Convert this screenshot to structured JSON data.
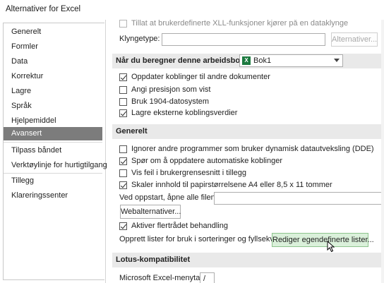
{
  "window": {
    "title": "Alternativer for Excel"
  },
  "sidebar": {
    "items": [
      {
        "label": "Generelt"
      },
      {
        "label": "Formler"
      },
      {
        "label": "Data"
      },
      {
        "label": "Korrektur"
      },
      {
        "label": "Lagre"
      },
      {
        "label": "Språk"
      },
      {
        "label": "Hjelpemiddel"
      },
      {
        "label": "Avansert",
        "active": true
      },
      {
        "label": "Tilpass båndet"
      },
      {
        "label": "Verktøylinje for hurtigtilgang"
      },
      {
        "label": "Tillegg"
      },
      {
        "label": "Klareringssenter"
      }
    ]
  },
  "top": {
    "faded_row": "Tillat at brukerdefinerte XLL-funksjoner kjører på en dataklynge",
    "klyngetype_label": "Klyngetype:",
    "alternativer_button": "Alternativer..."
  },
  "calc_section": {
    "header": "Når du beregner denne arbeidsboken:",
    "workbook": "Bok1",
    "options": [
      {
        "label": "Oppdater koblinger til andre dokumenter",
        "checked": true
      },
      {
        "label": "Angi presisjon som vist",
        "checked": false
      },
      {
        "label": "Bruk 1904-datosystem",
        "checked": false
      },
      {
        "label": "Lagre eksterne koblingsverdier",
        "checked": true
      }
    ]
  },
  "general_section": {
    "header": "Generelt",
    "options": [
      {
        "label": "Ignorer andre programmer som bruker dynamisk datautveksling (DDE)",
        "checked": false
      },
      {
        "label": "Spør om å oppdatere automatiske koblinger",
        "checked": true
      },
      {
        "label": "Vis feil i brukergrensesnitt i tillegg",
        "checked": false
      },
      {
        "label": "Skaler innhold til papirstørrelsene A4 eller 8,5 x 11 tommer",
        "checked": true
      }
    ],
    "startup_label": "Ved oppstart, åpne alle filene i:",
    "web_button": "Webalternativer...",
    "multithread_label": "Aktiver flertrådet behandling",
    "multithread_checked": true,
    "lists_label": "Opprett lister for bruk i sorteringer og fyllsekvenser:",
    "lists_button": "Rediger egendefinerte lister..."
  },
  "lotus_section": {
    "header": "Lotus-kompatibilitet",
    "menu_key_label": "Microsoft Excel-menytast:",
    "menu_key_value": "/"
  }
}
